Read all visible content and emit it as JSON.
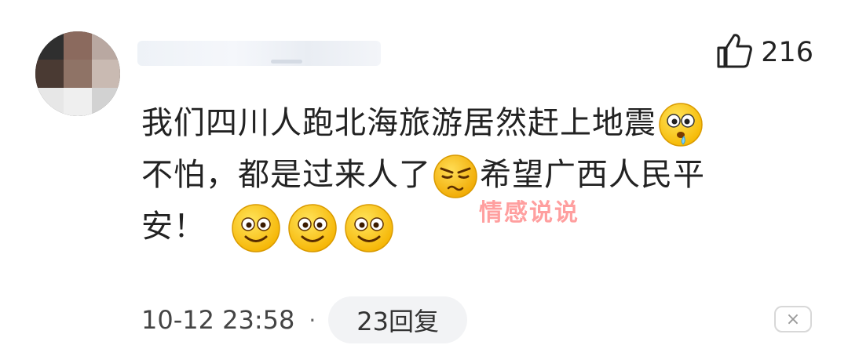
{
  "comment": {
    "likes": "216",
    "text_line1": "我们四川人跑北海旅游居然赶上地震",
    "text_line2a": "不怕，都是过来人了",
    "text_line2b": "希望广西人民平",
    "text_line3": "安！",
    "timestamp": "10-12 23:58",
    "separator": "·",
    "replies_label": "23回复",
    "close_glyph": "×"
  },
  "watermark": "情感说说",
  "icons": {
    "like": "thumbs-up-icon",
    "emoji_drool": "drooling-face-emoji-icon",
    "emoji_annoyed": "annoyed-face-emoji-icon",
    "emoji_smile": "smiling-face-emoji-icon",
    "close": "close-icon"
  },
  "colors": {
    "emoji_yellow": "#FFD43B",
    "watermark": "#FF5050",
    "pill_bg": "#F2F3F5"
  }
}
